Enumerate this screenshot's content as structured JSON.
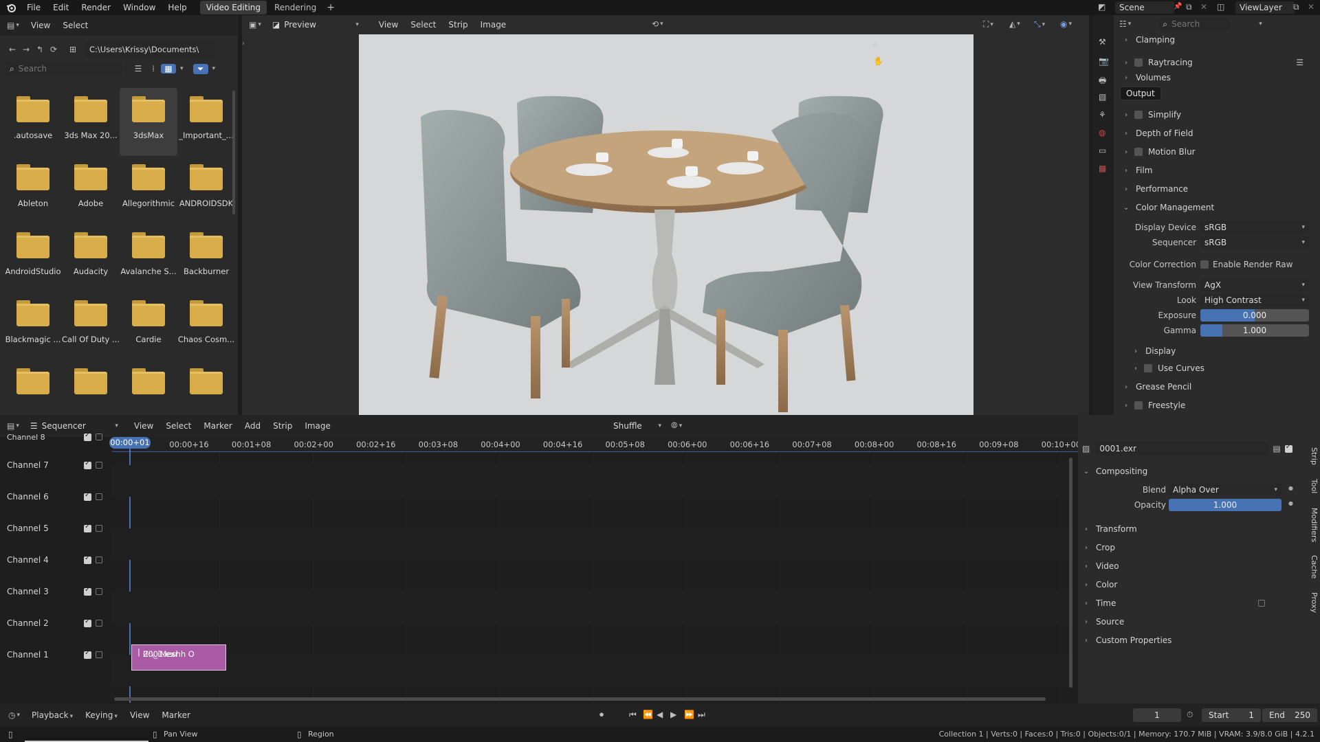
{
  "app": {
    "menus": [
      "File",
      "Edit",
      "Render",
      "Window",
      "Help"
    ],
    "workspaces": [
      "Video Editing",
      "Rendering"
    ],
    "active_workspace": "Video Editing",
    "scene_name": "Scene",
    "view_layer": "ViewLayer"
  },
  "file_browser": {
    "header_menus": [
      "View",
      "Select"
    ],
    "path": "C:\\Users\\Krissy\\Documents\\",
    "search_placeholder": "Search",
    "selected": "3dsMax",
    "folders": [
      ".autosave",
      "3ds Max 20...",
      "3dsMax",
      "_Important_...",
      "Ableton",
      "Adobe",
      "Allegorithmic",
      "ANDROIDSDK",
      "AndroidStudio",
      "Audacity",
      "Avalanche S...",
      "Backburner",
      "Blackmagic ...",
      "Call Of Duty ...",
      "Cardie",
      "Chaos Cosm...",
      "",
      "",
      "",
      ""
    ]
  },
  "preview": {
    "view_mode": "Preview",
    "menus": [
      "View",
      "Select",
      "Strip",
      "Image"
    ]
  },
  "properties": {
    "search_placeholder": "Search",
    "tooltip": "Output",
    "sections": {
      "clamping": "Clamping",
      "raytracing": "Raytracing",
      "volumes": "Volumes",
      "simplify": "Simplify",
      "depth_of_field": "Depth of Field",
      "motion_blur": "Motion Blur",
      "film": "Film",
      "performance": "Performance",
      "color_management": "Color Management",
      "display": "Display",
      "use_curves": "Use Curves",
      "grease_pencil": "Grease Pencil",
      "freestyle": "Freestyle"
    },
    "color_management": {
      "display_device_label": "Display Device",
      "display_device": "sRGB",
      "sequencer_label": "Sequencer",
      "sequencer": "sRGB",
      "color_correction_label": "Color Correction",
      "enable_render_raw": "Enable Render Raw",
      "view_transform_label": "View Transform",
      "view_transform": "AgX",
      "look_label": "Look",
      "look": "High Contrast",
      "exposure_label": "Exposure",
      "exposure": "0.000",
      "exposure_fill": 0.5,
      "gamma_label": "Gamma",
      "gamma": "1.000",
      "gamma_fill": 0.2
    }
  },
  "sequencer": {
    "editor": "Sequencer",
    "menus": [
      "View",
      "Select",
      "Marker",
      "Add",
      "Strip",
      "Image"
    ],
    "snap_mode": "Shuffle",
    "current_time": "00:00+01",
    "ruler_ticks": [
      "00:00+16",
      "00:01+08",
      "00:02+00",
      "00:02+16",
      "00:03+08",
      "00:04+00",
      "00:04+16",
      "00:05+08",
      "00:06+00",
      "00:06+16",
      "00:07+08",
      "00:08+00",
      "00:08+16",
      "00:09+08",
      "00:10+00"
    ],
    "channels": [
      "Channel 8",
      "Channel 7",
      "Channel 6",
      "Channel 5",
      "Channel 4",
      "Channel 3",
      "Channel 2",
      "Channel 1"
    ],
    "strip_name": "0001.exr",
    "strip_path": "Z:\\_iMeshh O"
  },
  "strip_sidebar": {
    "strip_name": "0001.exr",
    "compositing": "Compositing",
    "blend_label": "Blend",
    "blend": "Alpha Over",
    "opacity_label": "Opacity",
    "opacity": "1.000",
    "opacity_fill": 1.0,
    "sections": [
      "Transform",
      "Crop",
      "Video",
      "Color",
      "Time",
      "Source",
      "Custom Properties"
    ],
    "vertical_tabs": [
      "Strip",
      "Tool",
      "Modifiers",
      "Cache",
      "Proxy"
    ]
  },
  "footer": {
    "menus": [
      "Playback",
      "Keying",
      "View",
      "Marker"
    ],
    "current_frame": "1",
    "start_label": "Start",
    "start": "1",
    "end_label": "End",
    "end": "250"
  },
  "status": {
    "pan_view": "Pan View",
    "region": "Region",
    "stats": "Collection 1 | Verts:0 | Faces:0 | Tris:0 | Objects:0/1 | Memory: 170.7 MiB | VRAM: 3.9/8.0 GiB | 4.2.1"
  },
  "colors": {
    "accent": "#4772b3",
    "strip": "#a95aa4",
    "folder": "#d9ad4a"
  }
}
